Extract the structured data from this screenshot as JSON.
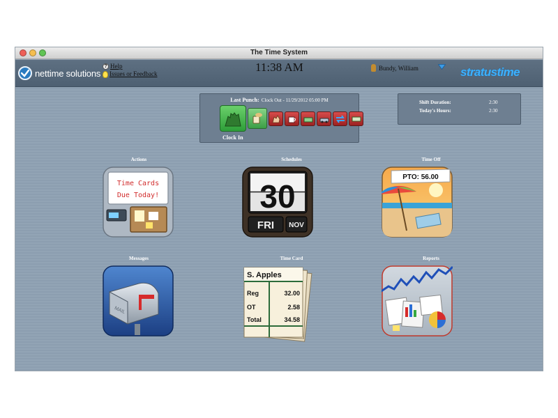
{
  "window": {
    "title": "The Time System"
  },
  "header": {
    "brand": "nettime solutions",
    "help_label": "Help",
    "feedback_label": "Issues or Feedback",
    "clock": "11:38 AM",
    "user_name": "Bundy, William",
    "logo_right": "stratustime"
  },
  "punch": {
    "last_punch_label": "Last Punch:",
    "last_punch_value": "Clock Out - 11/29/2012 05:00 PM",
    "clock_in_label": "Clock In"
  },
  "hours": {
    "shift_duration_label": "Shift Duration:",
    "shift_duration_value": "2:30",
    "todays_hours_label": "Today's Hours:",
    "todays_hours_value": "2:30"
  },
  "tiles": {
    "actions": {
      "label": "Actions",
      "board_line1": "Time Cards",
      "board_line2": "Due Today!"
    },
    "schedules": {
      "label": "Schedules",
      "day_number": "30",
      "weekday": "FRI",
      "month": "NOV"
    },
    "time_off": {
      "label": "Time Off",
      "pto": "PTO: 56.00"
    },
    "messages": {
      "label": "Messages",
      "mailbox_text": "MAIL"
    },
    "time_card": {
      "label": "Time Card",
      "employee": "S. Apples",
      "rows": [
        {
          "label": "Reg",
          "value": "32.00"
        },
        {
          "label": "OT",
          "value": "2.58"
        },
        {
          "label": "Total",
          "value": "34.58"
        }
      ]
    },
    "reports": {
      "label": "Reports"
    }
  },
  "colors": {
    "header_bg": "#566879",
    "content_bg": "#8fa1b2",
    "panel_bg": "#6e7f91",
    "accent_blue": "#3db1ff",
    "clock_in_green": "#3aa643"
  }
}
